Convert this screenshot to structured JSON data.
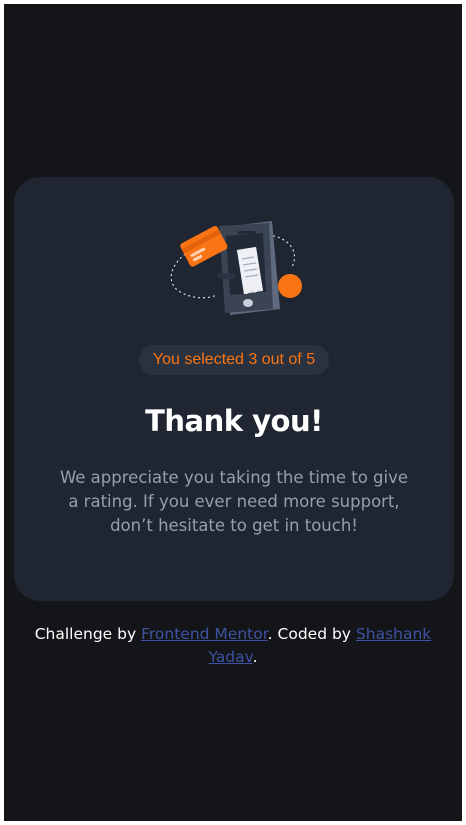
{
  "card": {
    "illustration_icon": "payment-phone-illustration",
    "rating_badge": "You selected 3 out of 5",
    "title": "Thank you!",
    "message": "We appreciate you taking the time to give a rating. If you ever need more support, don’t hesitate to get in touch!"
  },
  "attribution": {
    "prefix": "Challenge by ",
    "frontend_mentor_link": "Frontend Mentor",
    "middle": ". Coded by ",
    "author_link": "Shashank Yadav",
    "suffix": "."
  },
  "colors": {
    "background": "#131518",
    "card": "#1f2631",
    "accent": "#fb7413",
    "text_muted": "#969fad",
    "link": "#3e52a3"
  }
}
